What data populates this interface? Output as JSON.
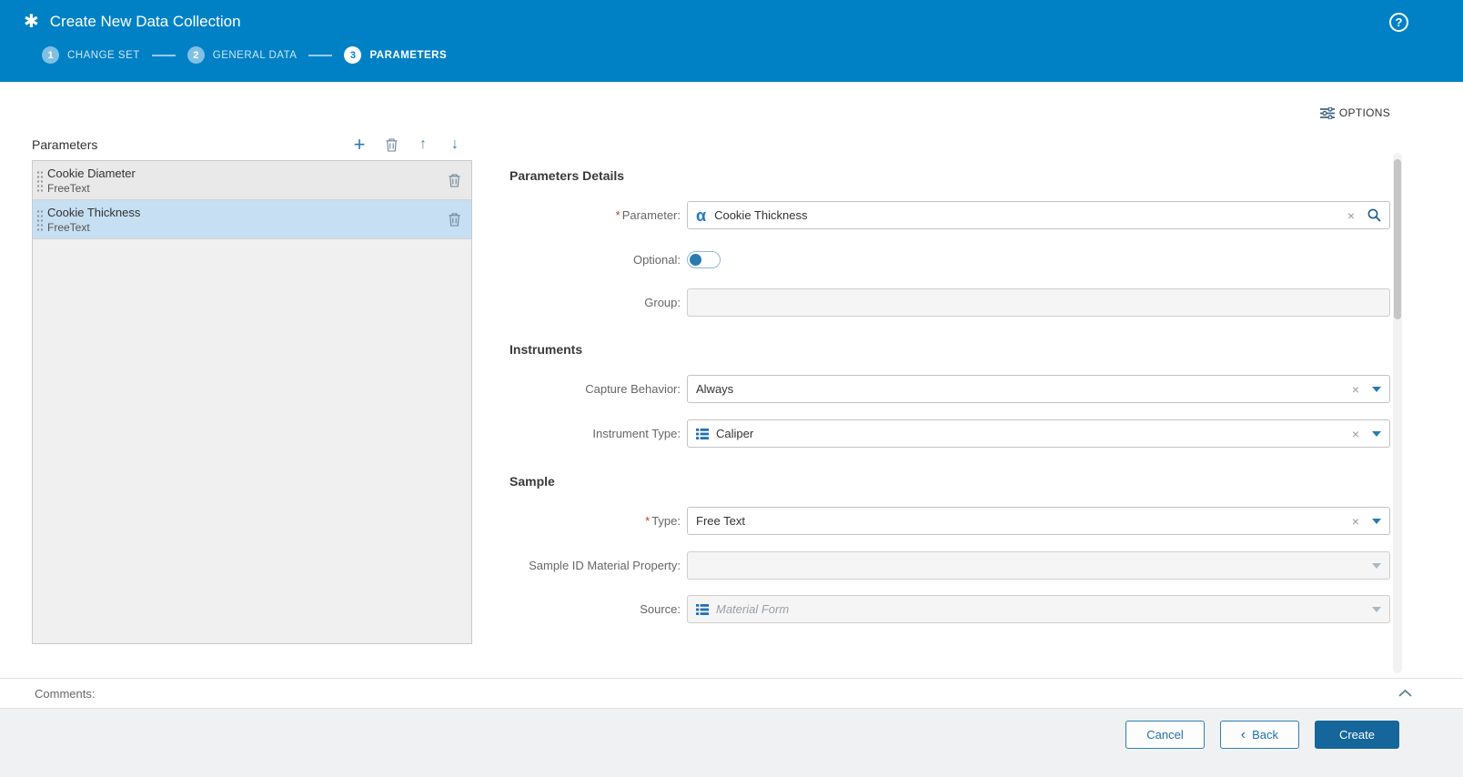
{
  "colors": {
    "header_blue": "#0081c6",
    "accent_blue": "#2a7ab0",
    "create_blue": "#15669a",
    "selected_item": "#c6dff2",
    "required_red": "#c0392b"
  },
  "header": {
    "app_icon": "✱",
    "title": "Create New Data Collection",
    "help_icon": "?",
    "steps": [
      {
        "number": "1",
        "label": "CHANGE SET",
        "state": "past"
      },
      {
        "number": "2",
        "label": "GENERAL DATA",
        "state": "past"
      },
      {
        "number": "3",
        "label": "PARAMETERS",
        "state": "active"
      }
    ]
  },
  "options": {
    "label": "OPTIONS"
  },
  "parameters_panel": {
    "title": "Parameters",
    "add_icon": "+",
    "move_up_icon": "↑",
    "move_down_icon": "↓",
    "items": [
      {
        "name": "Cookie Diameter",
        "type": "FreeText",
        "selected": false
      },
      {
        "name": "Cookie Thickness",
        "type": "FreeText",
        "selected": true
      }
    ]
  },
  "form": {
    "details": {
      "heading": "Parameters Details",
      "parameter": {
        "required": "*",
        "label": "Parameter:",
        "icon": "α",
        "value": "Cookie Thickness",
        "clear": "×"
      },
      "optional": {
        "label": "Optional:",
        "enabled": false
      },
      "group": {
        "label": "Group:",
        "value": ""
      }
    },
    "instruments": {
      "heading": "Instruments",
      "capture_behavior": {
        "label": "Capture Behavior:",
        "value": "Always",
        "clear": "×"
      },
      "instrument_type": {
        "label": "Instrument Type:",
        "value": "Caliper",
        "clear": "×"
      }
    },
    "sample": {
      "heading": "Sample",
      "type": {
        "required": "*",
        "label": "Type:",
        "value": "Free Text",
        "clear": "×"
      },
      "sample_id": {
        "label": "Sample ID Material Property:",
        "value": ""
      },
      "source": {
        "label": "Source:",
        "placeholder": "Material Form"
      }
    }
  },
  "comments": {
    "label": "Comments:"
  },
  "footer": {
    "cancel": "Cancel",
    "back_chevron": "‹",
    "back": "Back",
    "create": "Create"
  }
}
